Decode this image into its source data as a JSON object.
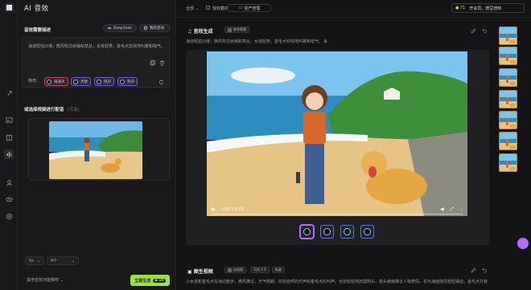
{
  "header": {
    "app_title": "AI 音效",
    "filter_all": "全部",
    "filter_favorites": "我收藏的",
    "asset_manage": "资产管理",
    "credits": "71",
    "membership": "开会员，赠豆增积"
  },
  "left_panel": {
    "desc_section": "音效需要描述",
    "deepseek_chip": "DeepSeek",
    "library_chip": "我的音效",
    "prompt_text": "海浪轻拍沙滩，微风吹过树梢和草丛，女孩轻笑，金毛犬欢快地叫着和喘气。",
    "recommend_label": "推荐：",
    "tags": [
      "海浪声",
      "犬吠",
      "风声",
      "笑声"
    ],
    "video_section": "或选择视频进行配音",
    "video_hint": "(可选)",
    "select_duration": "5s",
    "select_count": "4个",
    "bottom_link": "其他音效功能推荐",
    "generate_button": "立即生成",
    "generate_cost": "10"
  },
  "card1": {
    "title": "音效生成",
    "badge": "参考视频",
    "description": "海浪轻拍沙滩，微风吹过树梢和草丛，女孩轻笑，金毛犬欢快地叫着和喘气。",
    "player_time": "0:07 / 0:05"
  },
  "card2": {
    "title": "图生视频",
    "badge": "自创图",
    "tag_model": "可灵 1.6",
    "tag_mode": "标准",
    "description": "小女孩和金毛犬在海边散步，微风拂过，天气晴朗，欢快自然的乐声和金毛犬的叫声。女孩轻轻地抚摸狗头，镜头缓缓推近人物表情，花与海面随风轻轻摆动，金毛犬打转"
  },
  "colors": {
    "accent_green": "#9de04a",
    "accent_purple": "#b46cff",
    "background": "#141416"
  },
  "icons": [
    "logo-icon",
    "sparkle-icon",
    "image-icon",
    "soundwave-icon",
    "grid-icon",
    "eye-icon",
    "settings-icon",
    "copy-icon",
    "trash-icon",
    "refresh-icon",
    "edit-icon",
    "undo-icon",
    "play-icon",
    "volume-icon",
    "fullscreen-icon",
    "more-icon"
  ]
}
